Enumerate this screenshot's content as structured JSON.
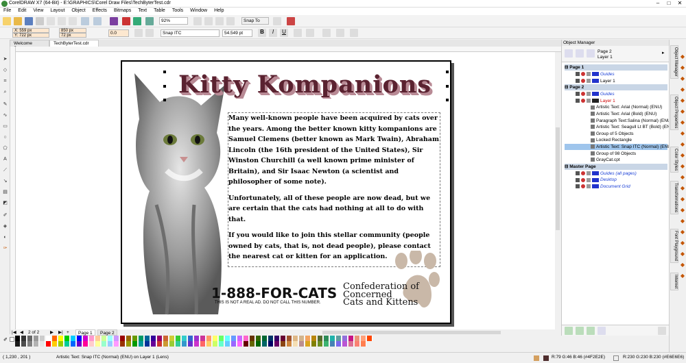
{
  "window": {
    "title": "CorelDRAW X7 (64-Bit) - E:\\GRAPHICS\\Corel Draw Files\\TechByterTest.cdr"
  },
  "menu": [
    "File",
    "Edit",
    "View",
    "Layout",
    "Object",
    "Effects",
    "Bitmaps",
    "Text",
    "Table",
    "Tools",
    "Window",
    "Help"
  ],
  "toolbar": {
    "zoom": "92%",
    "snap": "Snap To"
  },
  "propbar": {
    "x": "X: 559 px",
    "y": "Y: 722 px",
    "w": "850 px",
    "h": "72 px",
    "rotate": "0.0",
    "font": "Snap ITC",
    "size": "54.549 pt"
  },
  "tabs": [
    "Welcome Screen",
    "TechByterTest.cdr"
  ],
  "document": {
    "heading": "Kitty Kompanions",
    "paragraphs": [
      "Many well-known people have been acquired by cats over the years. Among the better known kitty kompanions are Samuel Clemens (better known as Mark Twain), Abraham Lincoln (the 16th president of the United States), Sir Winston Churchill (a well known prime minister of Britain), and Sir Isaac Newton (a scientist and philosopher of some note).",
      "Unfortunately, all of these people are now dead, but we are certain that the cats had nothing at all to do with that.",
      "If you would like to join this stellar community (people owned by cats, that is, not dead people), please contact the nearest cat or kitten for an application."
    ],
    "phone": "1-888-FOR-CATS",
    "phone_note": "THIS IS NOT A REAL AD. DO NOT CALL THIS NUMBER.",
    "org": [
      "Confederation of",
      "Concerned",
      "Cats and Kittens"
    ]
  },
  "pagenav": {
    "count": "2 of 2",
    "pages": [
      "Page 1",
      "Page 2"
    ]
  },
  "object_manager": {
    "title": "Object Manager",
    "current": [
      "Page 2",
      "Layer 1"
    ],
    "rows": [
      {
        "label": "Page 1",
        "type": "header",
        "indent": 0
      },
      {
        "label": "Guides",
        "type": "layer",
        "indent": 1,
        "italic": true,
        "color": "#1a3fd6"
      },
      {
        "label": "Layer 1",
        "type": "layer",
        "indent": 1
      },
      {
        "label": "Page 2",
        "type": "header",
        "indent": 0
      },
      {
        "label": "Guides",
        "type": "layer",
        "indent": 1,
        "italic": true,
        "color": "#1a3fd6"
      },
      {
        "label": "Layer 1",
        "type": "layer",
        "indent": 1,
        "color": "#d00000"
      },
      {
        "label": "Artistic Text: Arial (Normal) (ENU)",
        "type": "obj",
        "indent": 2
      },
      {
        "label": "Artistic Text: Arial (Bold) (ENU)",
        "type": "obj",
        "indent": 2
      },
      {
        "label": "Paragraph Text:Salina (Normal) (ENU)",
        "type": "obj",
        "indent": 2
      },
      {
        "label": "Artistic Text: Seagull Lt BT (Bold) (ENU)",
        "type": "obj",
        "indent": 2
      },
      {
        "label": "Group of 5 Objects",
        "type": "obj",
        "indent": 2
      },
      {
        "label": "Locked Rectangle",
        "type": "obj",
        "indent": 2
      },
      {
        "label": "Artistic Text: Snap ITC (Normal) (ENU)",
        "type": "obj",
        "indent": 2,
        "selected": true
      },
      {
        "label": "Group of 98 Objects",
        "type": "obj",
        "indent": 2
      },
      {
        "label": "GrayCat.cpt",
        "type": "obj",
        "indent": 2
      },
      {
        "label": "Master Page",
        "type": "header",
        "indent": 0
      },
      {
        "label": "Guides (all pages)",
        "type": "layer",
        "indent": 1,
        "italic": true,
        "color": "#1a3fd6"
      },
      {
        "label": "Desktop",
        "type": "layer",
        "indent": 1,
        "italic": true,
        "color": "#1a3fd6"
      },
      {
        "label": "Document Grid",
        "type": "layer",
        "indent": 1,
        "italic": true,
        "color": "#1a3fd6"
      }
    ]
  },
  "dock_tabs": [
    "Object Manager",
    "Object Properties",
    "Color Styles",
    "Transformations",
    "Font Playground",
    "Internet"
  ],
  "status": {
    "coords": "( 1,230 , 201 )",
    "info": "Artistic Text: Snap ITC (Normal) (ENU) on Layer 1 (Lens)",
    "fill": "R:79 G:46 B:46 (#4F2E2E)",
    "outline": "R:230 G:230 B:230 (#E6E6E6)"
  },
  "palette": [
    "#000000",
    "#1a1a1a",
    "#333333",
    "#4d4d4d",
    "#666666",
    "#808080",
    "#999999",
    "#b3b3b3",
    "#cccccc",
    "#e6e6e6",
    "#ffffff",
    "#ff0000",
    "#ff6600",
    "#ffcc00",
    "#ffff00",
    "#99cc00",
    "#00cc00",
    "#00cc99",
    "#00ccff",
    "#0066ff",
    "#0000ff",
    "#6600cc",
    "#cc00cc",
    "#ff0099",
    "#ff99cc",
    "#ffcccc",
    "#ffcc99",
    "#ffff99",
    "#ccff99",
    "#99ffcc",
    "#99ffff",
    "#99ccff",
    "#cc99ff",
    "#ff99ff",
    "#990000",
    "#993300",
    "#996600",
    "#999900",
    "#669900",
    "#009900",
    "#009966",
    "#009999",
    "#006699",
    "#003399",
    "#330099",
    "#660099",
    "#990066",
    "#cc3333",
    "#cc6633",
    "#cc9933",
    "#cccc33",
    "#99cc33",
    "#33cc33",
    "#33cc99",
    "#33cccc",
    "#3399cc",
    "#3366cc",
    "#6633cc",
    "#9933cc",
    "#cc33cc",
    "#cc3399",
    "#ff6666",
    "#ff9966",
    "#ffcc66",
    "#ffff66",
    "#ccff66",
    "#66ff66",
    "#66ffcc",
    "#66ffff",
    "#66ccff",
    "#6699ff",
    "#9966ff",
    "#cc66ff",
    "#ff66ff",
    "#ff66cc",
    "#660000",
    "#663300",
    "#666600",
    "#336600",
    "#006600",
    "#006633",
    "#006666",
    "#003366",
    "#000066",
    "#330066",
    "#660066",
    "#660033",
    "#8b4513",
    "#a0522d",
    "#cd853f",
    "#deb887",
    "#f5deb3",
    "#d2b48c",
    "#bc8f8f",
    "#f4a460",
    "#daa520",
    "#b8860b",
    "#808000",
    "#556b2f",
    "#6b8e23",
    "#2e8b57",
    "#3cb371",
    "#20b2aa",
    "#4682b4",
    "#5f9ea0",
    "#7b68ee",
    "#9370db",
    "#ba55d3",
    "#c71585",
    "#db7093",
    "#e9967a",
    "#fa8072",
    "#ffa07a",
    "#ff7f50",
    "#ff4500"
  ]
}
